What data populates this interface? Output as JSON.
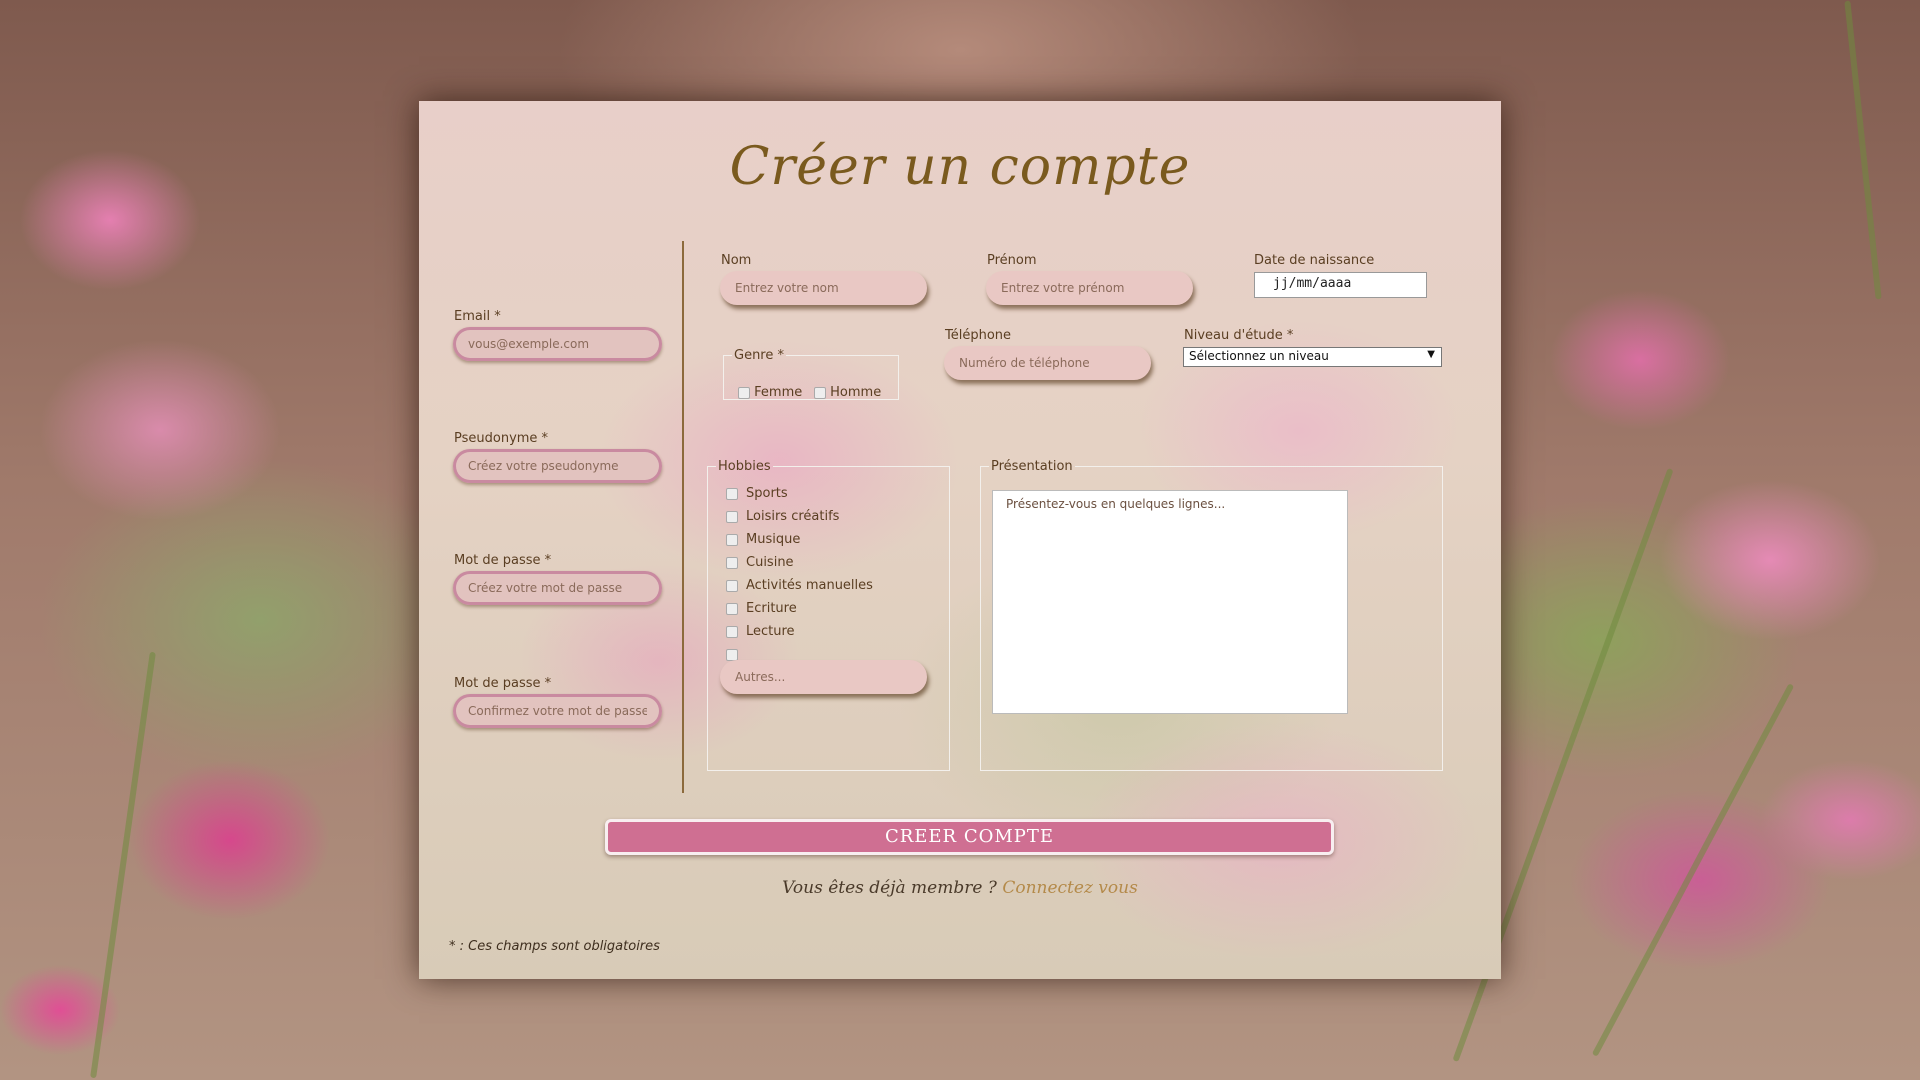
{
  "title": "Créer un compte",
  "left_fields": [
    {
      "label": "Email *",
      "placeholder": "vous@exemple.com"
    },
    {
      "label": "Pseudonyme *",
      "placeholder": "Créez votre pseudonyme"
    },
    {
      "label": "Mot de passe *",
      "placeholder": "Créez votre mot de passe"
    },
    {
      "label": "Mot de passe *",
      "placeholder": "Confirmez votre mot de passe"
    }
  ],
  "nom": {
    "label": "Nom",
    "placeholder": "Entrez votre nom"
  },
  "prenom": {
    "label": "Prénom",
    "placeholder": "Entrez votre prénom"
  },
  "naissance": {
    "label": "Date de naissance",
    "value": "jj/mm/aaaa"
  },
  "genre": {
    "legend": "Genre *",
    "options": [
      "Femme",
      "Homme"
    ]
  },
  "telephone": {
    "label": "Téléphone",
    "placeholder": "Numéro de téléphone"
  },
  "niveau": {
    "label": "Niveau d'étude *",
    "selected": "Sélectionnez un niveau",
    "arrow": "▼"
  },
  "hobbies": {
    "legend": "Hobbies",
    "items": [
      "Sports",
      "Loisirs créatifs",
      "Musique",
      "Cuisine",
      "Activités manuelles",
      "Ecriture",
      "Lecture",
      ""
    ],
    "autres_placeholder": "Autres..."
  },
  "presentation": {
    "legend": "Présentation",
    "placeholder": "Présentez-vous en quelques lignes..."
  },
  "submit_label": "CREER COMPTE",
  "already": {
    "text": "Vous êtes déjà membre ? ",
    "link": "Connectez vous"
  },
  "footnote": "* : Ces champs sont obligatoires"
}
